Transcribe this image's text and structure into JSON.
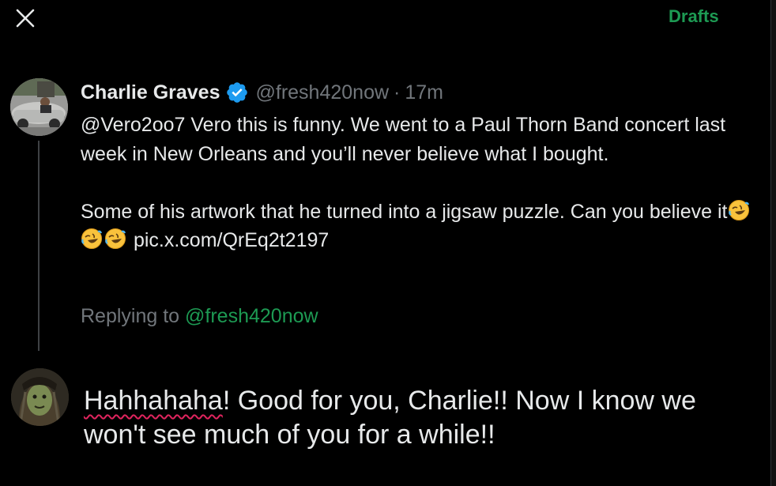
{
  "header": {
    "close_icon": "close-icon",
    "drafts_label": "Drafts"
  },
  "colors": {
    "accent": "#1d9a53",
    "text": "#e7e9ea",
    "muted": "#71767b",
    "verified": "#1d9bf0",
    "background": "#000000",
    "spellcheck": "#e0245e"
  },
  "tweet": {
    "author_name": "Charlie Graves",
    "verified_icon": "verified-badge-icon",
    "handle": "@fresh420now",
    "separator": "·",
    "time": "17m",
    "text_line1": "@Vero2oo7 Vero this is funny. We went to a Paul Thorn Band concert last week in New Orleans and you’ll never believe what I bought.",
    "text_line2_prefix": "Some of his artwork that he turned into a jigsaw puzzle. Can you believe it",
    "emoji_icon": "rolling-on-floor-laughing-icon",
    "emoji_count": 3,
    "link": "pic.x.com/QrEq2t2197"
  },
  "replying": {
    "prefix": "Replying to ",
    "mention": "@fresh420now"
  },
  "reply": {
    "misspelled_word": "Hahhahaha",
    "text_rest": "! Good for you, Charlie!! Now I know we won't see much of you for a while!!"
  }
}
